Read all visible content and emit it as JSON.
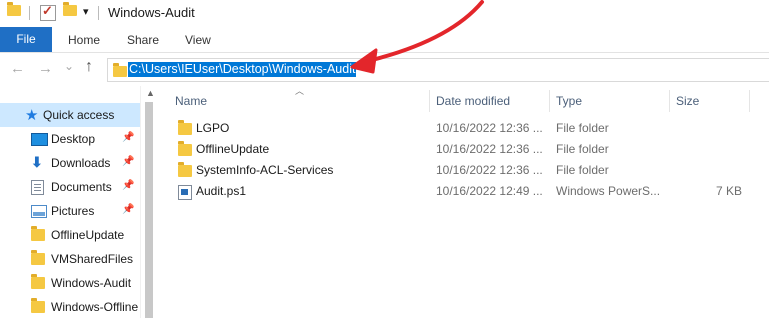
{
  "window": {
    "title": "Windows-Audit"
  },
  "ribbon": {
    "tabs": [
      "File",
      "Home",
      "Share",
      "View"
    ]
  },
  "address": {
    "path": "C:\\Users\\IEUser\\Desktop\\Windows-Audit"
  },
  "nav": {
    "back": "←",
    "forward": "→",
    "recent": "⌄",
    "up": "↑",
    "qa_dropdown": "▾"
  },
  "sidebar": {
    "items": [
      {
        "label": "Quick access",
        "icon": "star-icon",
        "pinned": false
      },
      {
        "label": "Desktop",
        "icon": "desktop-icon",
        "pinned": true
      },
      {
        "label": "Downloads",
        "icon": "download-icon",
        "pinned": true
      },
      {
        "label": "Documents",
        "icon": "documents-icon",
        "pinned": true
      },
      {
        "label": "Pictures",
        "icon": "pictures-icon",
        "pinned": true
      },
      {
        "label": "OfflineUpdate",
        "icon": "folder-icon",
        "pinned": false
      },
      {
        "label": "VMSharedFiles",
        "icon": "folder-icon",
        "pinned": false
      },
      {
        "label": "Windows-Audit",
        "icon": "folder-icon",
        "pinned": false
      },
      {
        "label": "Windows-Offline",
        "icon": "folder-icon",
        "pinned": false
      }
    ]
  },
  "columns": {
    "name": "Name",
    "date": "Date modified",
    "type": "Type",
    "size": "Size"
  },
  "files": [
    {
      "name": "LGPO",
      "date": "10/16/2022 12:36 ...",
      "type": "File folder",
      "size": "",
      "icon": "folder-icon"
    },
    {
      "name": "OfflineUpdate",
      "date": "10/16/2022 12:36 ...",
      "type": "File folder",
      "size": "",
      "icon": "folder-icon"
    },
    {
      "name": "SystemInfo-ACL-Services",
      "date": "10/16/2022 12:36 ...",
      "type": "File folder",
      "size": "",
      "icon": "folder-icon"
    },
    {
      "name": "Audit.ps1",
      "date": "10/16/2022 12:49 ...",
      "type": "Windows PowerS...",
      "size": "7 KB",
      "icon": "powershell-script-icon"
    }
  ],
  "colors": {
    "accent": "#1f6fc5",
    "selection": "#0078d7",
    "annotation": "#e3262b",
    "folder": "#f5c842"
  }
}
